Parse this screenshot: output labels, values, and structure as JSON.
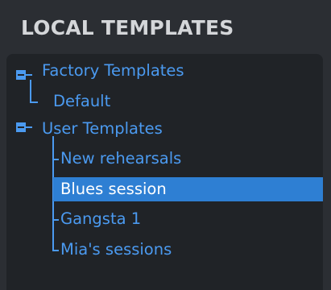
{
  "panel": {
    "title": "LOCAL TEMPLATES"
  },
  "tree": {
    "groups": [
      {
        "label": "Factory Templates",
        "children": [
          {
            "label": "Default"
          }
        ]
      },
      {
        "label": "User Templates",
        "children": [
          {
            "label": "New rehearsals"
          },
          {
            "label": "Blues session",
            "selected": true
          },
          {
            "label": "Gangsta 1"
          },
          {
            "label": "Mia's sessions"
          }
        ]
      }
    ]
  },
  "colors": {
    "background": "#2b2e33",
    "tree_background": "#202327",
    "accent": "#4b9af0",
    "selection": "#2e7fd3",
    "title_text": "#d4d6d9"
  },
  "icons": {
    "expander": "minus-box-icon",
    "connector": "tree-line-icon"
  }
}
